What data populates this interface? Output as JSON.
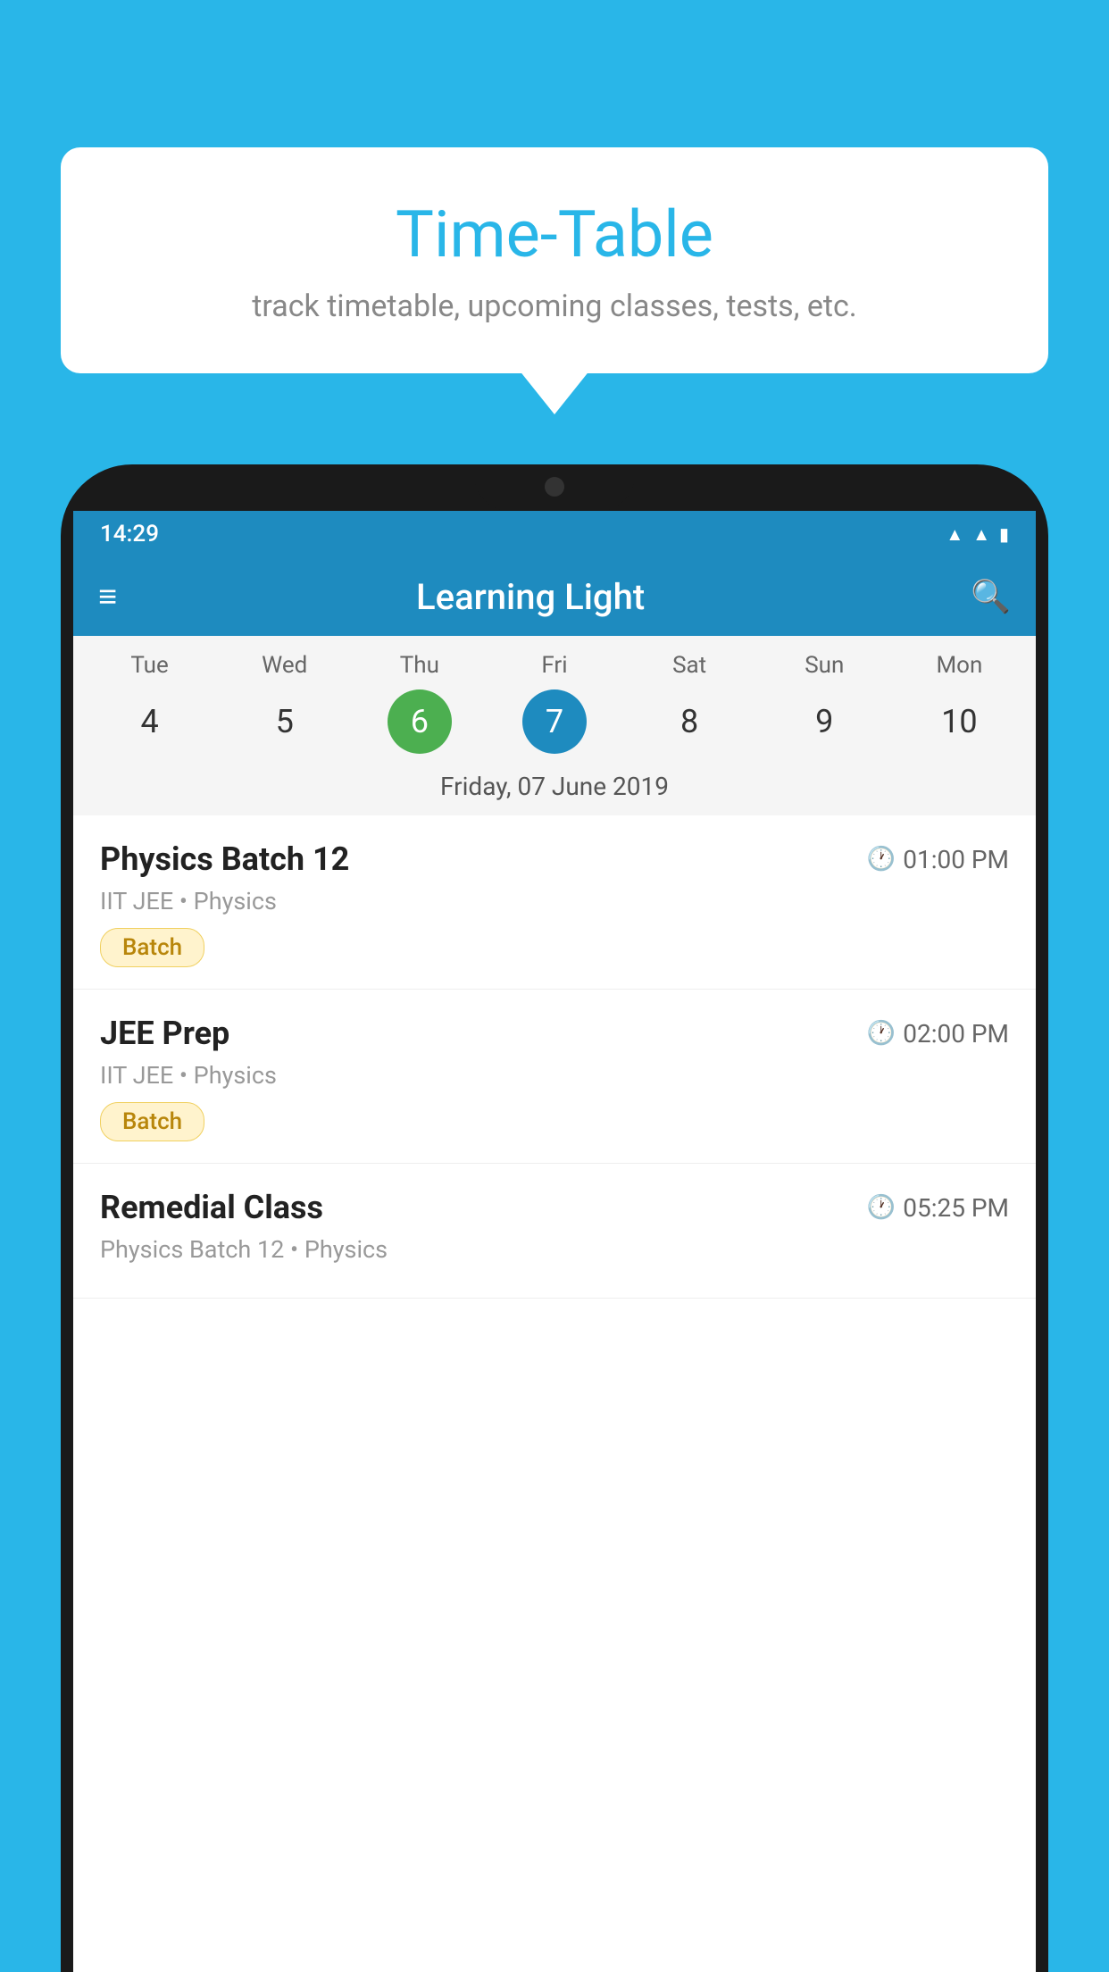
{
  "background_color": "#29b6e8",
  "bubble": {
    "title": "Time-Table",
    "subtitle": "track timetable, upcoming classes, tests, etc."
  },
  "phone": {
    "status_bar": {
      "time": "14:29"
    },
    "app_bar": {
      "title": "Learning Light"
    },
    "calendar": {
      "days": [
        {
          "name": "Tue",
          "num": "4",
          "state": "normal"
        },
        {
          "name": "Wed",
          "num": "5",
          "state": "normal"
        },
        {
          "name": "Thu",
          "num": "6",
          "state": "today"
        },
        {
          "name": "Fri",
          "num": "7",
          "state": "selected"
        },
        {
          "name": "Sat",
          "num": "8",
          "state": "normal"
        },
        {
          "name": "Sun",
          "num": "9",
          "state": "normal"
        },
        {
          "name": "Mon",
          "num": "10",
          "state": "normal"
        }
      ],
      "selected_date_label": "Friday, 07 June 2019"
    },
    "schedule": [
      {
        "title": "Physics Batch 12",
        "time": "01:00 PM",
        "meta": "IIT JEE • Physics",
        "badge": "Batch"
      },
      {
        "title": "JEE Prep",
        "time": "02:00 PM",
        "meta": "IIT JEE • Physics",
        "badge": "Batch"
      },
      {
        "title": "Remedial Class",
        "time": "05:25 PM",
        "meta": "Physics Batch 12 • Physics",
        "badge": null
      }
    ]
  }
}
